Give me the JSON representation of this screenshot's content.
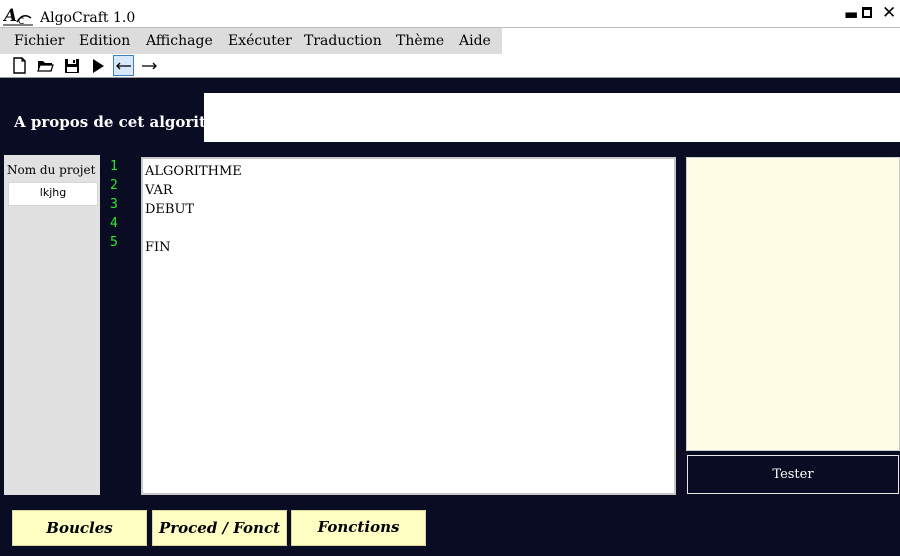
{
  "window": {
    "title": "AlgoCraft 1.0"
  },
  "menu": [
    "Fichier",
    "Edition",
    "Affichage",
    "Exécuter",
    "Traduction",
    "Thème",
    "Aide"
  ],
  "toolbar": {
    "icons": [
      "new-file-icon",
      "open-folder-icon",
      "save-icon",
      "run-icon",
      "undo-icon",
      "redo-icon"
    ],
    "active": "undo-icon"
  },
  "about": {
    "label": "A propos de cet algorithme",
    "value": ""
  },
  "project": {
    "label": "Nom du projet :",
    "name": "lkjhg"
  },
  "editor": {
    "line_numbers": [
      "1",
      "2",
      "3",
      "4",
      "5"
    ],
    "lines": [
      "ALGORITHME",
      "VAR",
      "DEBUT",
      "",
      "FIN"
    ]
  },
  "test_button": "Tester",
  "bottom_buttons": [
    "Boucles",
    "Proced / Fonct",
    "Fonctions"
  ],
  "colors": {
    "background": "#0a0c24",
    "line_numbers": "#2ee62e",
    "output_panel": "#fffde6",
    "bottom_buttons": "#ffffc4"
  }
}
